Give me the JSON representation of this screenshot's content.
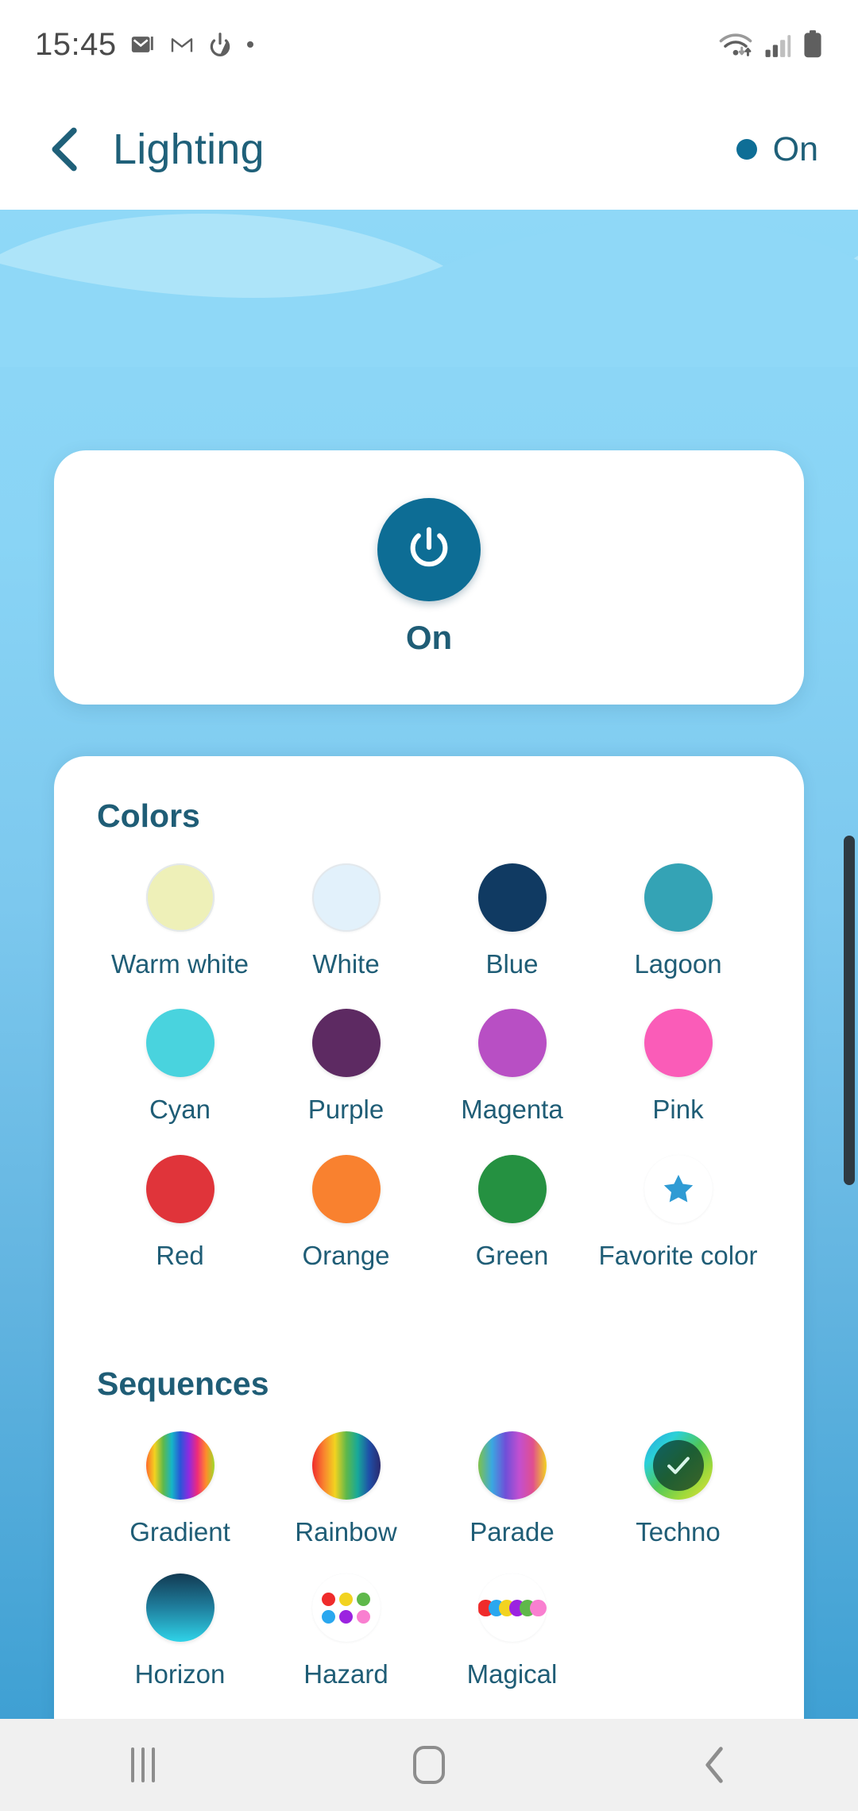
{
  "status_bar": {
    "clock": "15:45",
    "left_icons": [
      "email-icon",
      "gmail-icon",
      "power-saving-icon",
      "dot-indicator-icon"
    ],
    "right_icons": [
      "wifi-icon",
      "cellular-signal-icon",
      "battery-icon"
    ]
  },
  "header": {
    "back_icon": "chevron-left-icon",
    "title": "Lighting",
    "state_label": "On",
    "state_dot_color": "#0e6e96"
  },
  "power_card": {
    "icon": "power-icon",
    "label": "On",
    "button_color": "#0d6d95"
  },
  "colors": {
    "title": "Colors",
    "items": [
      {
        "label": "Warm white",
        "color": "#eef0b8",
        "outline": true
      },
      {
        "label": "White",
        "color": "#e2f1fb",
        "outline": true
      },
      {
        "label": "Blue",
        "color": "#103a62",
        "outline": false
      },
      {
        "label": "Lagoon",
        "color": "#34a3b5",
        "outline": false
      },
      {
        "label": "Cyan",
        "color": "#49d3de",
        "outline": false
      },
      {
        "label": "Purple",
        "color": "#5d2a62",
        "outline": false
      },
      {
        "label": "Magenta",
        "color": "#b84fc4",
        "outline": false
      },
      {
        "label": "Pink",
        "color": "#fa5cb8",
        "outline": false
      },
      {
        "label": "Red",
        "color": "#e0343a",
        "outline": false
      },
      {
        "label": "Orange",
        "color": "#f9812f",
        "outline": false
      },
      {
        "label": "Green",
        "color": "#259141",
        "outline": false
      },
      {
        "label": "Favorite color",
        "color": "#ffffff",
        "outline": true,
        "icon": "star-icon",
        "icon_color": "#2f9bd4"
      }
    ]
  },
  "sequences": {
    "title": "Sequences",
    "selected": "Techno",
    "check_icon": "check-icon",
    "items": [
      {
        "label": "Gradient",
        "style": "gradient-stripes"
      },
      {
        "label": "Rainbow",
        "style": "rainbow-sweep"
      },
      {
        "label": "Parade",
        "style": "parade-sweep"
      },
      {
        "label": "Techno",
        "style": "techno-ring",
        "selected": true
      },
      {
        "label": "Horizon",
        "style": "horizon-fade"
      },
      {
        "label": "Hazard",
        "style": "hazard-dots",
        "dots": [
          "#ef2b2b",
          "#f2d320",
          "#5fb84a",
          "#2aa7ef",
          "#9b23e0",
          "#f97fd0"
        ]
      },
      {
        "label": "Magical",
        "style": "magical-dots",
        "dots": [
          "#ef2b2b",
          "#2aa7ef",
          "#f2d320",
          "#9b23e0",
          "#5fb84a",
          "#f97fd0"
        ]
      }
    ]
  },
  "nav_bar": {
    "recents": "recents-icon",
    "home": "home-icon",
    "back": "back-icon"
  }
}
